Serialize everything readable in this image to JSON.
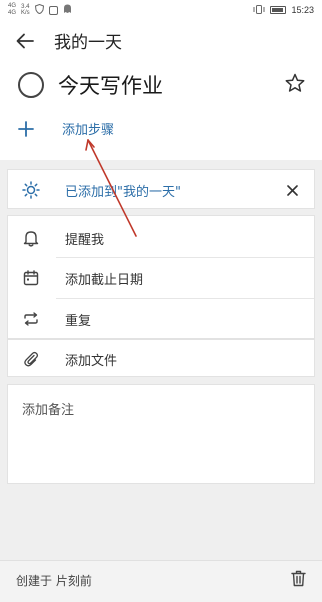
{
  "status_bar": {
    "network": "4G\n4G",
    "speed": "3.4\nK/s",
    "time": "15:23"
  },
  "header": {
    "list_title": "我的一天",
    "task_title": "今天写作业",
    "add_step_label": "添加步骤"
  },
  "my_day": {
    "label": "已添加到\"我的一天\""
  },
  "options": {
    "remind_label": "提醒我",
    "due_date_label": "添加截止日期",
    "repeat_label": "重复",
    "file_label": "添加文件"
  },
  "note": {
    "placeholder": "添加备注"
  },
  "footer": {
    "created_label": "创建于 片刻前"
  },
  "colors": {
    "accent": "#2c6ea8",
    "annotation_arrow": "#c0392b"
  },
  "icons": {
    "back": "arrow-left-icon",
    "task": "circle-checkbox-icon",
    "star": "star-icon",
    "add": "plus-icon",
    "my_day": "sun-icon",
    "close": "close-icon",
    "remind": "bell-icon",
    "due_date": "calendar-icon",
    "repeat": "repeat-icon",
    "file": "paperclip-icon",
    "delete": "trash-icon"
  }
}
